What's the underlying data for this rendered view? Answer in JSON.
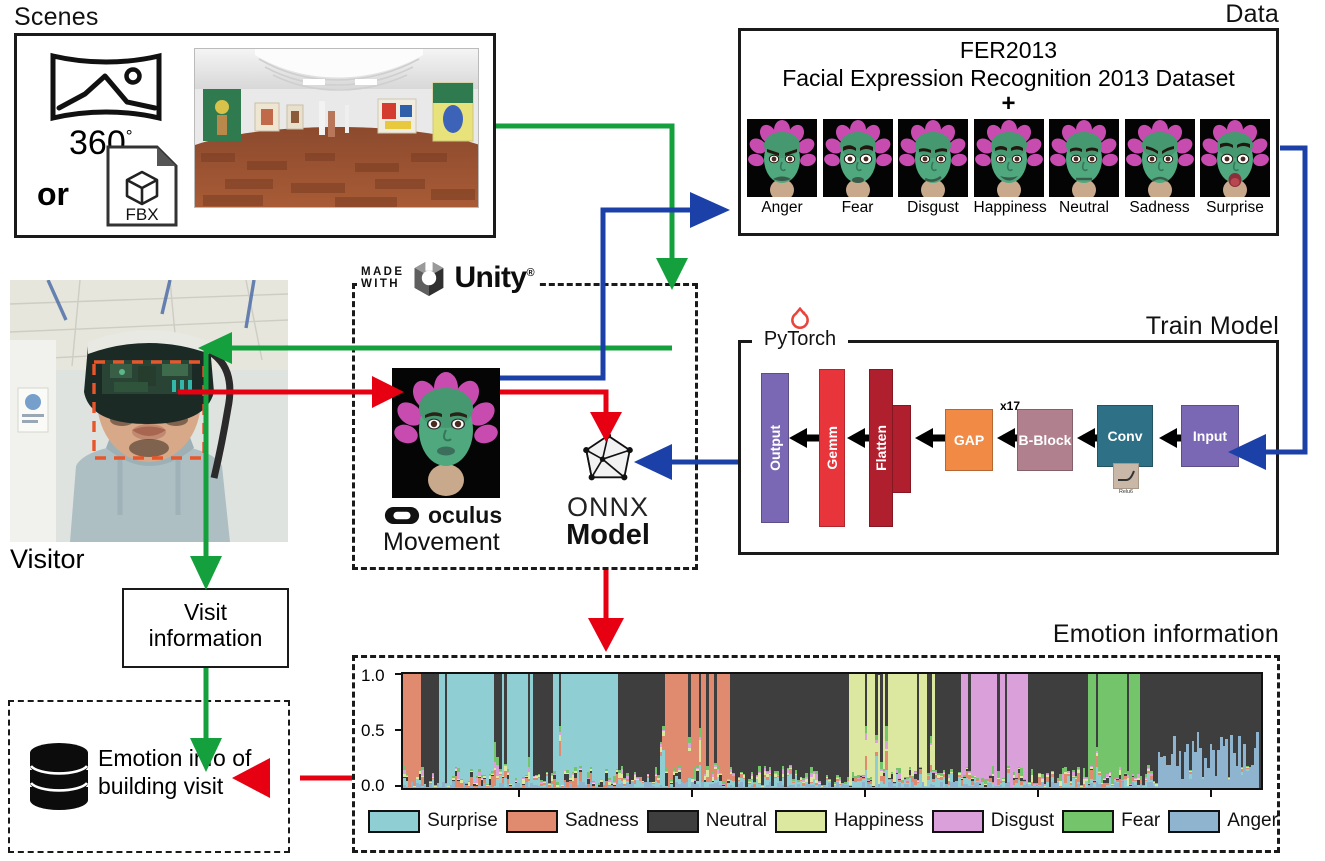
{
  "sections": {
    "scenes": "Scenes",
    "data": "Data",
    "train": "Train Model",
    "emotion": "Emotion information",
    "visitor": "Visitor"
  },
  "scenes": {
    "degree_label": "360",
    "degree_sup": "°",
    "or_label": "or",
    "fbx_label": "FBX",
    "pano_icon": "panorama-360-icon",
    "fbx_icon": "fbx-file-icon",
    "pano_image_alt": "360 degree art gallery panorama"
  },
  "data": {
    "dataset_name": "FER2013",
    "dataset_full": "Facial Expression Recognition 2013 Dataset",
    "plus": "+",
    "faces": [
      {
        "label": "Anger"
      },
      {
        "label": "Fear"
      },
      {
        "label": "Disgust"
      },
      {
        "label": "Happiness"
      },
      {
        "label": "Neutral"
      },
      {
        "label": "Sadness"
      },
      {
        "label": "Surprise"
      }
    ]
  },
  "train": {
    "framework": "PyTorch",
    "framework_icon": "pytorch-flame-icon",
    "repeat_label": "x17",
    "activation_label": "Relu6",
    "blocks": [
      {
        "label": "Output",
        "color": "#7B68B5"
      },
      {
        "label": "Gemm",
        "color": "#E8353C"
      },
      {
        "label": "Flatten",
        "color": "#B01F2E"
      },
      {
        "label": "GAP",
        "color": "#F08A45"
      },
      {
        "label": "B-Block",
        "color": "#B0808F"
      },
      {
        "label": "Conv",
        "color": "#2E7086"
      },
      {
        "label": "Input",
        "color": "#7B68B5"
      }
    ]
  },
  "unity": {
    "made": "MADE",
    "with": "WITH",
    "brand": "Unity",
    "registered": "®",
    "unity_icon": "unity-cube-icon",
    "oculus_brand": "oculus",
    "oculus_icon": "oculus-logo-icon",
    "movement": "Movement",
    "avatar_alt": "oculus movement avatar face",
    "onnx_name": "ONNX",
    "onnx_model": "Model",
    "onnx_icon": "onnx-polyhedron-icon"
  },
  "flow": {
    "visit_info_line1": "Visit",
    "visit_info_line2": "information",
    "db_line1": "Emotion info of",
    "db_line2": "building visit",
    "db_icon": "database-cylinder-icon"
  },
  "colors": {
    "green_arrow": "#14A03C",
    "blue_arrow": "#1B41A8",
    "red_arrow": "#E60012",
    "face_box": "#E8562B"
  },
  "chart_data": {
    "type": "area",
    "title": "Emotion information",
    "xlabel": "",
    "ylabel": "",
    "ylim": [
      0.0,
      1.0
    ],
    "yticks": [
      "0.0",
      "0.5",
      "1.0"
    ],
    "grid": false,
    "legend_position": "bottom",
    "stacked": true,
    "normalized": true,
    "series": [
      {
        "name": "Surprise",
        "color": "#8FCFD4"
      },
      {
        "name": "Sadness",
        "color": "#E08A70"
      },
      {
        "name": "Neutral",
        "color": "#3E3E3E"
      },
      {
        "name": "Happiness",
        "color": "#DCE8A0"
      },
      {
        "name": "Disgust",
        "color": "#D9A0D9"
      },
      {
        "name": "Fear",
        "color": "#74C46B"
      },
      {
        "name": "Anger",
        "color": "#8FB4D0"
      }
    ],
    "dominant_segments": [
      {
        "from_pct": 0,
        "to_pct": 2,
        "emotion": "Sadness"
      },
      {
        "from_pct": 2,
        "to_pct": 4,
        "emotion": "Neutral"
      },
      {
        "from_pct": 4,
        "to_pct": 15,
        "emotion": "Surprise"
      },
      {
        "from_pct": 15,
        "to_pct": 17,
        "emotion": "Neutral"
      },
      {
        "from_pct": 17,
        "to_pct": 25,
        "emotion": "Surprise"
      },
      {
        "from_pct": 25,
        "to_pct": 30,
        "emotion": "Neutral"
      },
      {
        "from_pct": 30,
        "to_pct": 38,
        "emotion": "Sadness"
      },
      {
        "from_pct": 38,
        "to_pct": 52,
        "emotion": "Neutral"
      },
      {
        "from_pct": 52,
        "to_pct": 62,
        "emotion": "Happiness"
      },
      {
        "from_pct": 62,
        "to_pct": 65,
        "emotion": "Neutral"
      },
      {
        "from_pct": 65,
        "to_pct": 73,
        "emotion": "Disgust"
      },
      {
        "from_pct": 73,
        "to_pct": 80,
        "emotion": "Neutral"
      },
      {
        "from_pct": 80,
        "to_pct": 86,
        "emotion": "Fear"
      },
      {
        "from_pct": 86,
        "to_pct": 100,
        "emotion": "Neutral"
      }
    ]
  }
}
